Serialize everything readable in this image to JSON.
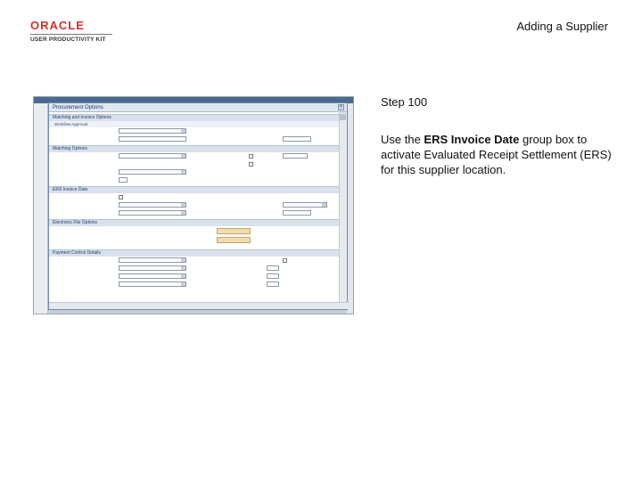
{
  "logo": {
    "brand": "ORACLE",
    "product": "USER PRODUCTIVITY KIT"
  },
  "slide_title": "Adding a Supplier",
  "step": "Step 100",
  "instruction": {
    "before": "Use the ",
    "bold": "ERS Invoice Date",
    "after": " group box to activate Evaluated Receipt Settlement (ERS) for this supplier location."
  },
  "screenshot": {
    "dialog_title": "Procurement Options",
    "close_glyph": "×",
    "sections": {
      "matching": "Matching and Invoice Options",
      "workflow": "Workflow Approval",
      "matching_options": "Matching Options",
      "ers": "ERS Invoice Date",
      "electronic": "Electronic File Options",
      "payment": "Payment Control Details"
    }
  }
}
